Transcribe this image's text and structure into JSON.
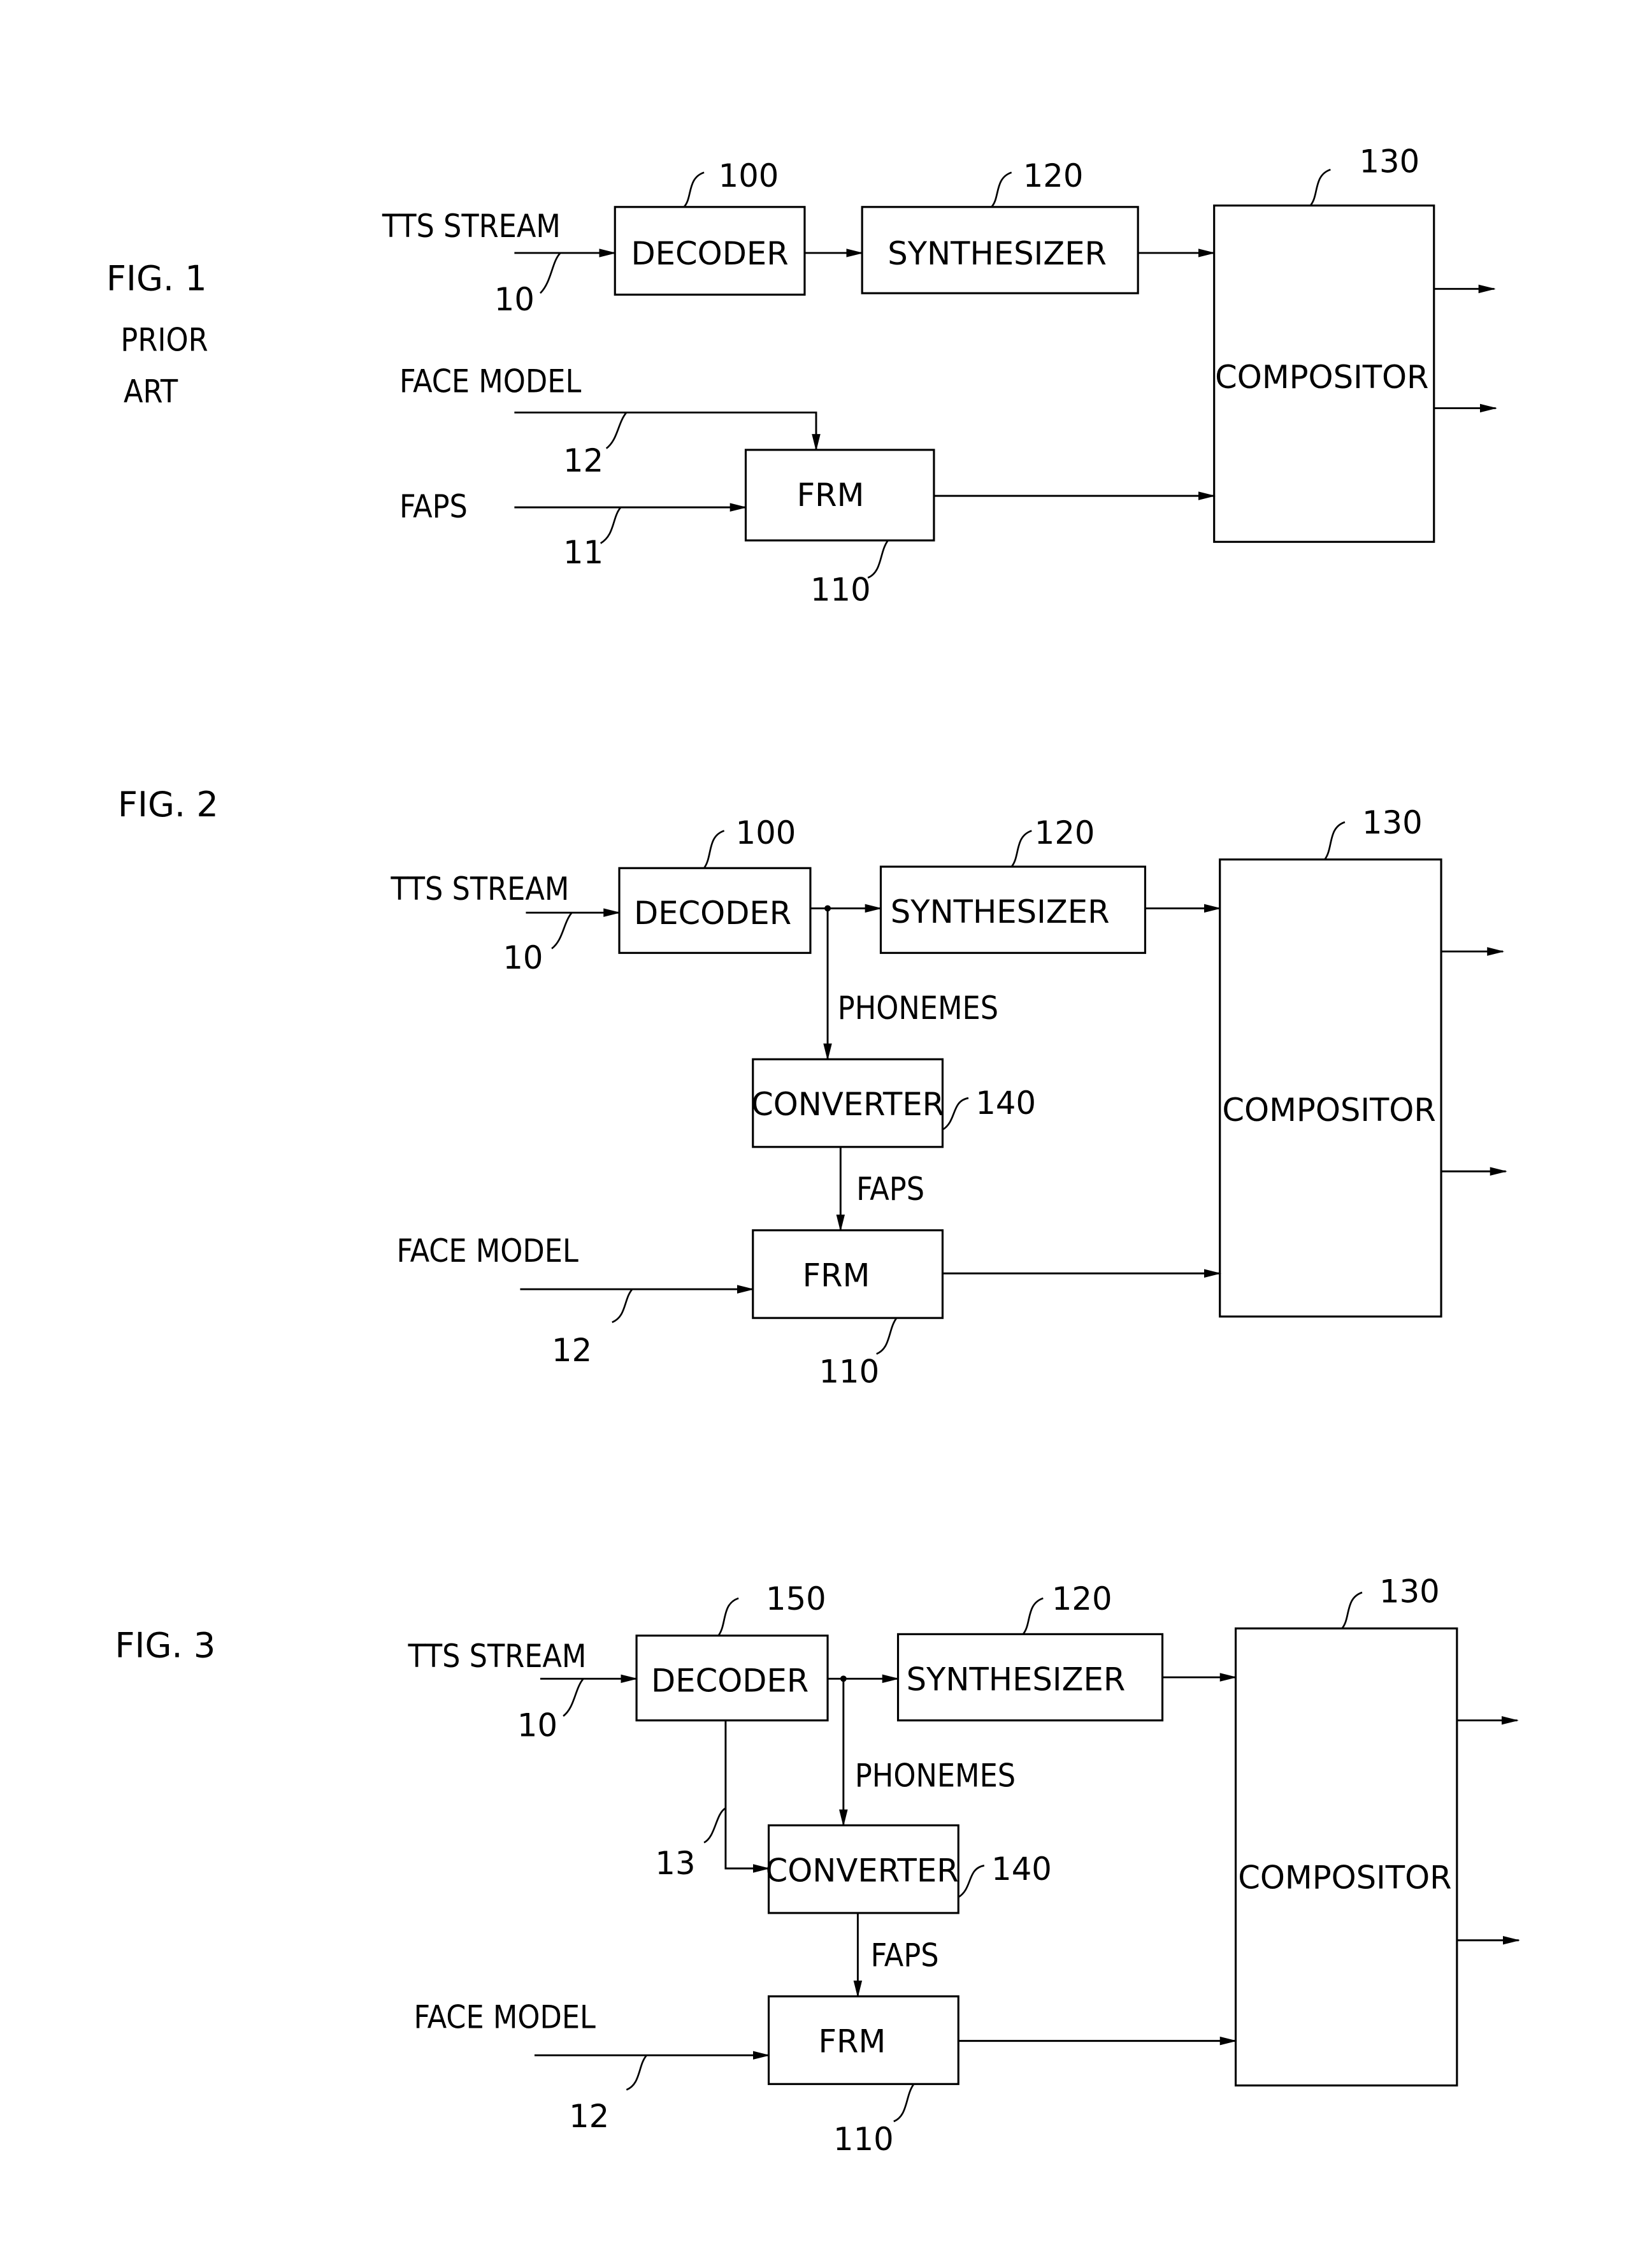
{
  "page": {
    "background": "#ffffff",
    "ink": "#000000"
  },
  "figures": [
    {
      "id": "fig1",
      "title": "FIG. 1",
      "subtitle": [
        "PRIOR",
        "ART"
      ],
      "inputs": {
        "tts_stream": "TTS STREAM",
        "face_model": "FACE MODEL",
        "faps": "FAPS"
      },
      "refs": {
        "tts": "10",
        "faps": "11",
        "face_model": "12",
        "decoder": "100",
        "frm": "110",
        "synth": "120",
        "compositor": "130"
      },
      "blocks": {
        "decoder": "DECODER",
        "synthesizer": "SYNTHESIZER",
        "frm": "FRM",
        "compositor": "COMPOSITOR"
      }
    },
    {
      "id": "fig2",
      "title": "FIG. 2",
      "inputs": {
        "tts_stream": "TTS STREAM",
        "face_model": "FACE MODEL"
      },
      "signals": {
        "phonemes": "PHONEMES",
        "faps": "FAPS"
      },
      "refs": {
        "tts": "10",
        "face_model": "12",
        "decoder": "100",
        "frm": "110",
        "synth": "120",
        "compositor": "130",
        "converter": "140"
      },
      "blocks": {
        "decoder": "DECODER",
        "synthesizer": "SYNTHESIZER",
        "converter": "CONVERTER",
        "frm": "FRM",
        "compositor": "COMPOSITOR"
      }
    },
    {
      "id": "fig3",
      "title": "FIG. 3",
      "inputs": {
        "tts_stream": "TTS STREAM",
        "face_model": "FACE MODEL"
      },
      "signals": {
        "phonemes": "PHONEMES",
        "faps": "FAPS"
      },
      "refs": {
        "tts": "10",
        "face_model": "12",
        "side": "13",
        "decoder": "150",
        "frm": "110",
        "synth": "120",
        "compositor": "130",
        "converter": "140"
      },
      "blocks": {
        "decoder": "DECODER",
        "synthesizer": "SYNTHESIZER",
        "converter": "CONVERTER",
        "frm": "FRM",
        "compositor": "COMPOSITOR"
      }
    }
  ]
}
